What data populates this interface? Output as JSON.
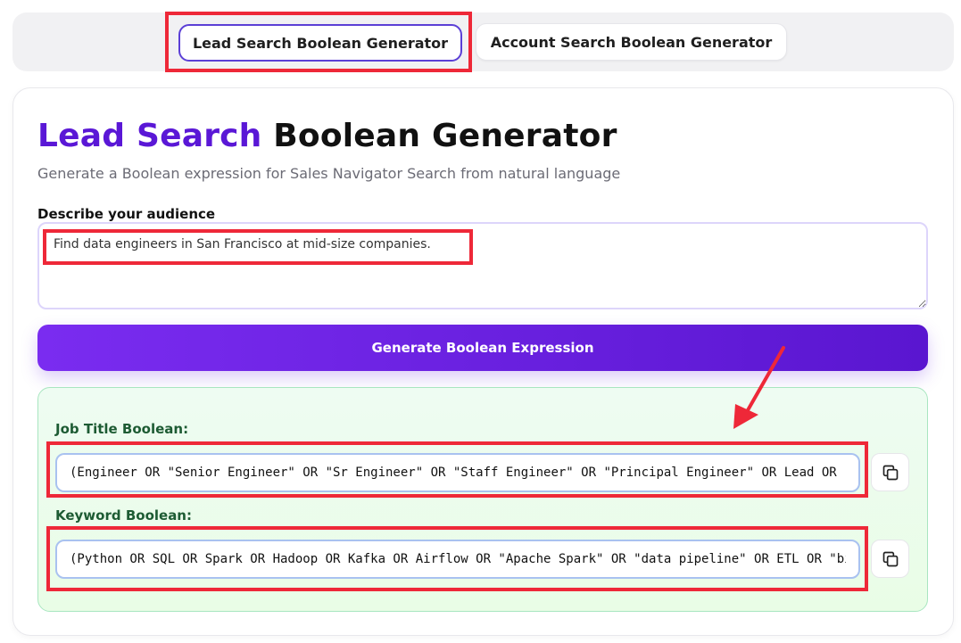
{
  "tabs": [
    {
      "label": "Lead Search Boolean Generator",
      "active": true
    },
    {
      "label": "Account Search Boolean Generator",
      "active": false
    }
  ],
  "header": {
    "title_accent": "Lead Search",
    "title_rest": "Boolean Generator",
    "subtitle": "Generate a Boolean expression for Sales Navigator Search from natural language"
  },
  "form": {
    "audience_label": "Describe your audience",
    "audience_value": "Find data engineers in San Francisco at mid-size companies.",
    "generate_label": "Generate Boolean Expression"
  },
  "results": {
    "job_title_label": "Job Title Boolean:",
    "job_title_value": "(Engineer OR \"Senior Engineer\" OR \"Sr Engineer\" OR \"Staff Engineer\" OR \"Principal Engineer\" OR Lead OR \"",
    "keyword_label": "Keyword Boolean:",
    "keyword_value": "(Python OR SQL OR Spark OR Hadoop OR Kafka OR Airflow OR \"Apache Spark\" OR \"data pipeline\" OR ETL OR \"bi"
  },
  "icons": {
    "copy": "copy-icon"
  },
  "colors": {
    "accent": "#5a17d6",
    "button_gradient_start": "#7a2cf0",
    "button_gradient_end": "#5a16d0",
    "result_label": "#1d5b33",
    "highlight": "#ee2838"
  }
}
